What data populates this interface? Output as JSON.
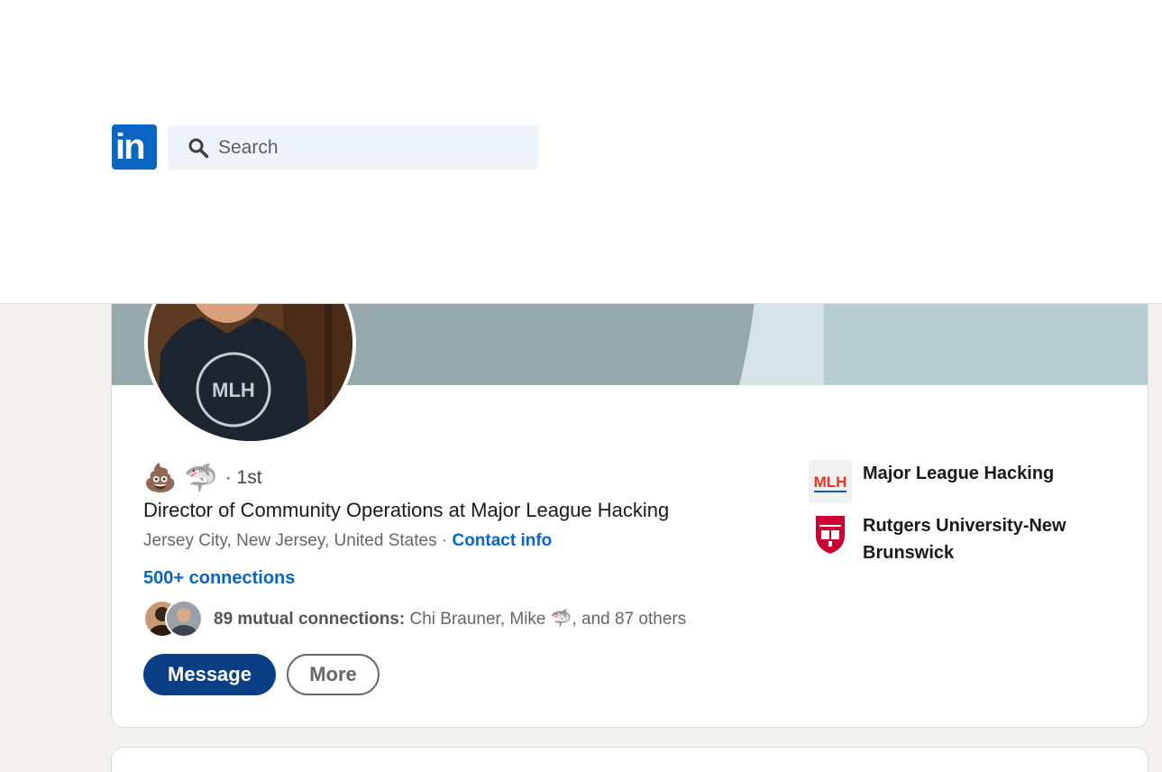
{
  "header": {
    "logo_text": "in",
    "search": {
      "placeholder": "Search"
    }
  },
  "profile": {
    "emoji_1": "💩",
    "emoji_2": "🦈",
    "degree": "· 1st",
    "headline": "Director of Community Operations at Major League Hacking",
    "location": "Jersey City, New Jersey, United States",
    "separator": "·",
    "contact_info_label": "Contact info",
    "connections_label": "500+ connections",
    "mutual": {
      "count_label": "89 mutual connections:",
      "names_pre": "Chi Brauner, Mike",
      "names_emoji": "🦈",
      "names_post": ", and 87 others"
    },
    "actions": {
      "message_label": "Message",
      "more_label": "More"
    },
    "avatar_shirt_text": "MLH",
    "organizations": [
      {
        "name": "Major League Hacking",
        "logo_text": "MLH"
      },
      {
        "name": "Rutgers University-New Brunswick"
      }
    ]
  },
  "colors": {
    "brand": "#0a66c2",
    "message_button": "#0a3f85",
    "cover_main": "#95a9ab",
    "cover_light": "#d6e3e6",
    "cover_right": "#b7cdd1"
  }
}
